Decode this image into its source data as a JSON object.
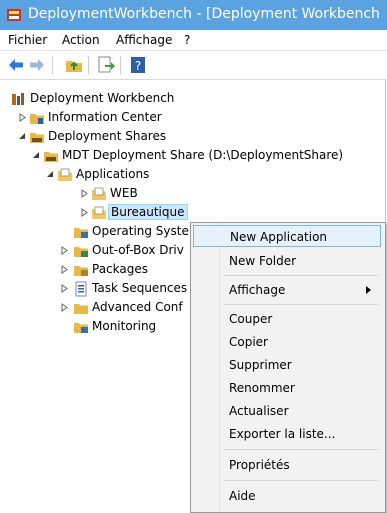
{
  "window": {
    "title": "DeploymentWorkbench - [Deployment Workbench"
  },
  "menubar": [
    "Fichier",
    "Action",
    "Affichage",
    "?"
  ],
  "toolbar": {
    "icons": [
      "back-arrow-icon",
      "forward-arrow-icon",
      "up-folder-icon",
      "export-list-icon",
      "help-icon"
    ]
  },
  "tree": {
    "root": "Deployment Workbench",
    "information_center": "Information Center",
    "deployment_shares": "Deployment Shares",
    "mdt_share": "MDT Deployment Share (D:\\DeploymentShare)",
    "applications": "Applications",
    "web": "WEB",
    "bureautique": "Bureautique",
    "operating_systems": "Operating Syste",
    "out_of_box": "Out-of-Box Driv",
    "packages": "Packages",
    "task_sequences": "Task Sequences",
    "advanced_config": "Advanced Conf",
    "monitoring": "Monitoring"
  },
  "context_menu": {
    "items": [
      "New Application",
      "New Folder",
      "Affichage",
      "Couper",
      "Copier",
      "Supprimer",
      "Renommer",
      "Actualiser",
      "Exporter la liste...",
      "Propriétés",
      "Aide"
    ],
    "highlighted": "New Application"
  },
  "colors": {
    "titlebar": "#5ba3e0",
    "selection": "#cce8ff",
    "menu_highlight": "#e5f1fb",
    "folder": "#e8b84a"
  }
}
